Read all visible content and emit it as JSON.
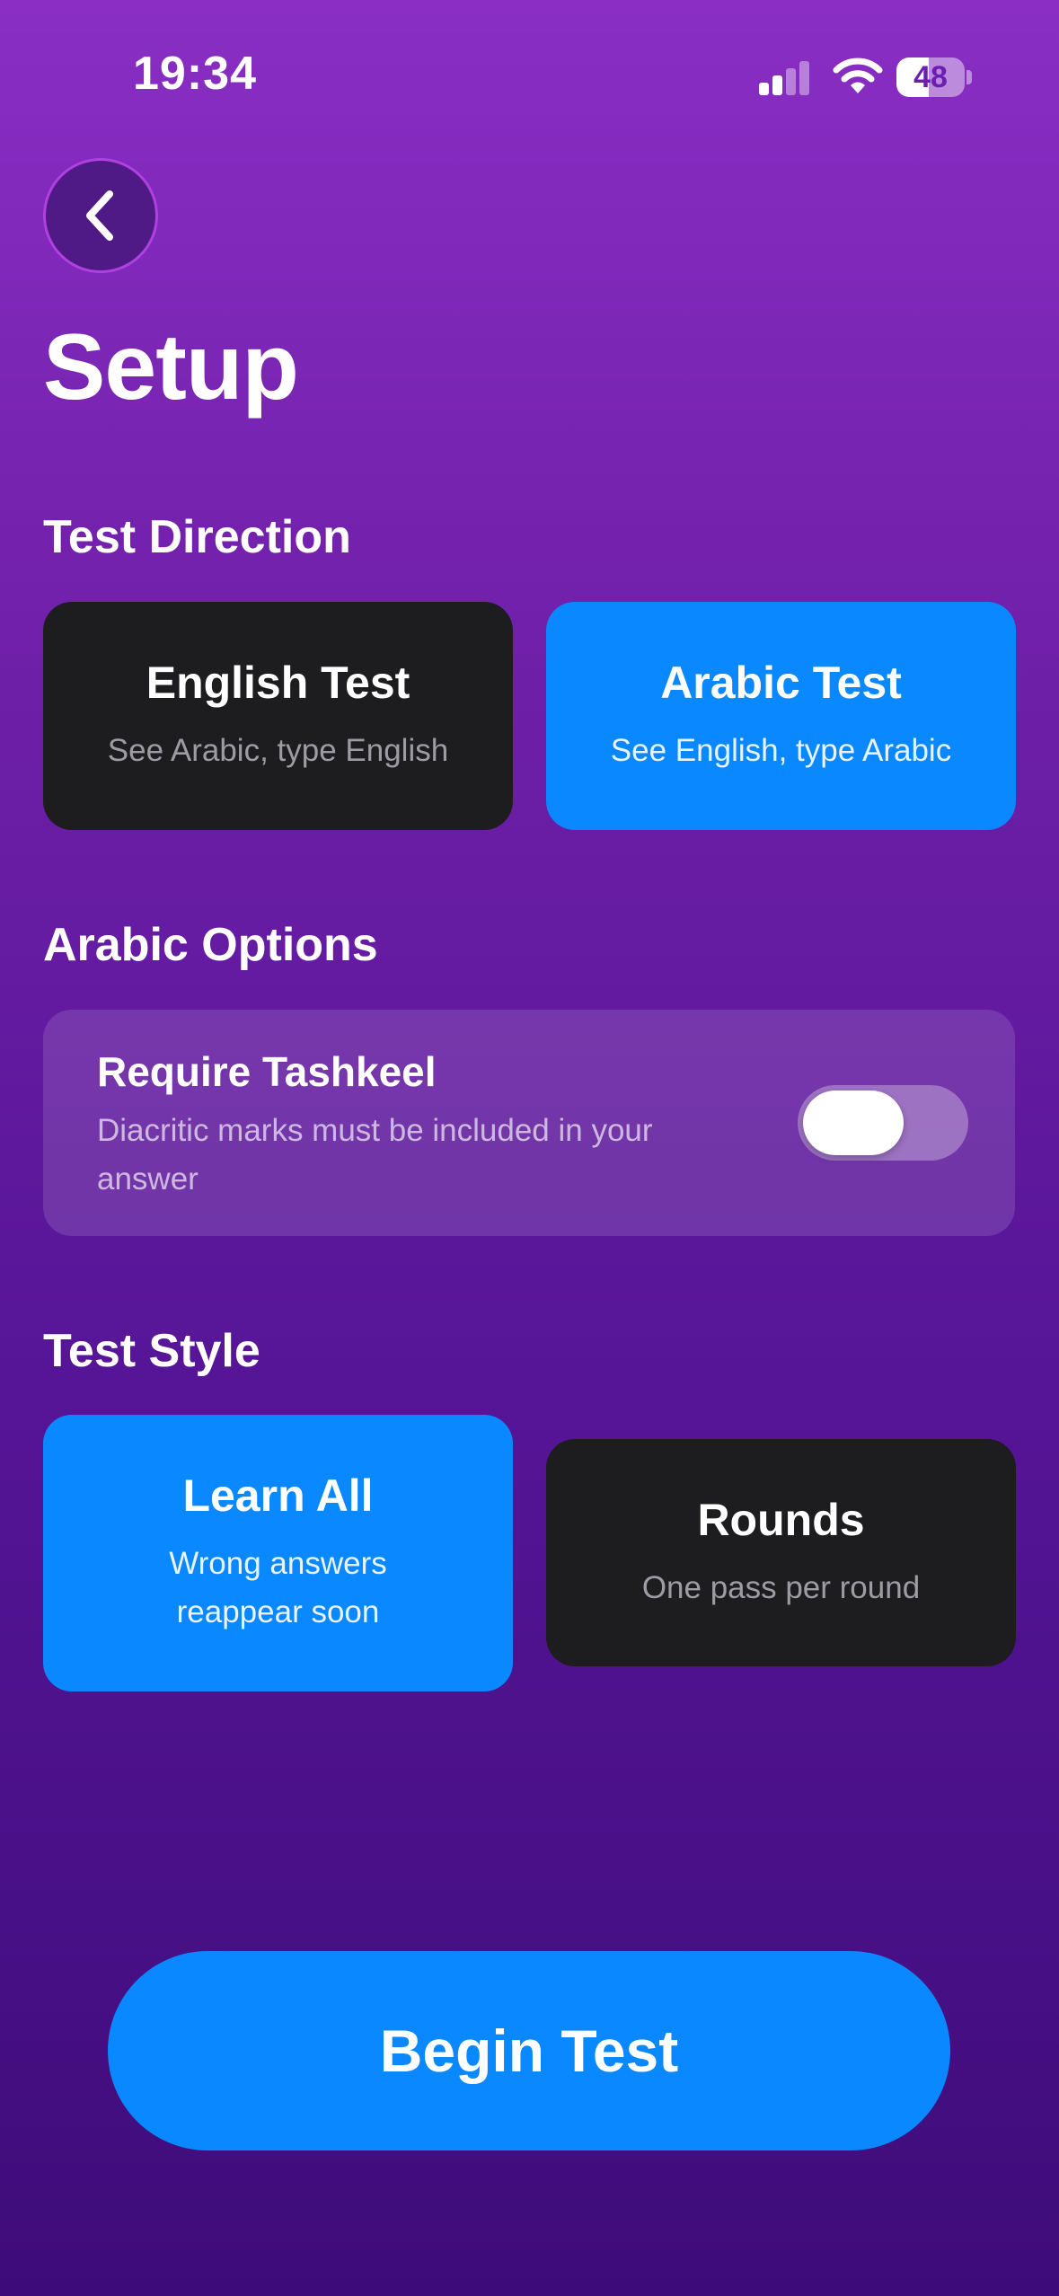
{
  "status_bar": {
    "time": "19:34",
    "battery_level": "48",
    "battery_fraction": 0.48
  },
  "header": {
    "back_icon": "chevron-left-icon",
    "title": "Setup"
  },
  "test_direction": {
    "heading": "Test Direction",
    "options": [
      {
        "title": "English Test",
        "subtitle": "See Arabic, type English",
        "selected": false
      },
      {
        "title": "Arabic Test",
        "subtitle": "See English, type Arabic",
        "selected": true
      }
    ]
  },
  "arabic_options": {
    "heading": "Arabic Options",
    "require_tashkeel": {
      "label": "Require Tashkeel",
      "description": "Diacritic marks must be included in your answer",
      "enabled": false
    }
  },
  "test_style": {
    "heading": "Test Style",
    "options": [
      {
        "title": "Learn All",
        "subtitle": "Wrong answers reappear soon",
        "selected": true
      },
      {
        "title": "Rounds",
        "subtitle": "One pass per round",
        "selected": false
      }
    ]
  },
  "actions": {
    "begin_label": "Begin Test"
  },
  "colors": {
    "accent_blue": "#0a88ff",
    "card_dark": "#1d1d1f",
    "background_top": "#8a2ec4",
    "background_bottom": "#3e0c7a"
  }
}
